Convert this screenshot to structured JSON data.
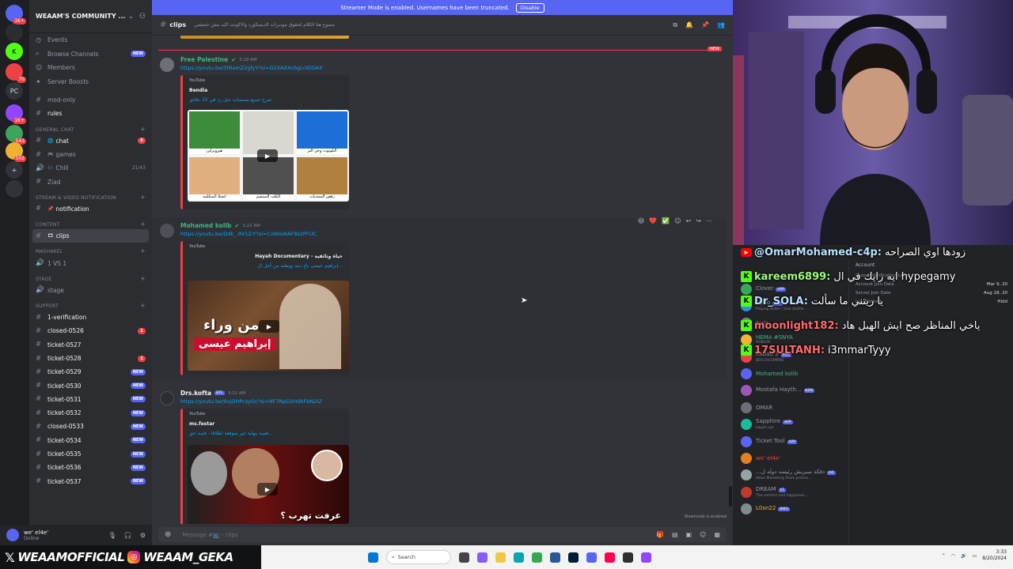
{
  "banner": {
    "text": "Streamer Mode is enabled. Usernames have been truncated.",
    "button": "Disable"
  },
  "rail": {
    "servers": [
      {
        "label": "",
        "badge": "1K+"
      },
      {
        "label": "",
        "badge": ""
      },
      {
        "label": "K",
        "badge": ""
      },
      {
        "label": "",
        "badge": "70"
      },
      {
        "label": "PC",
        "badge": ""
      },
      {
        "label": "",
        "badge": "1K+"
      },
      {
        "label": "",
        "badge": "543"
      },
      {
        "label": "",
        "badge": "502"
      },
      {
        "label": "+",
        "badge": ""
      },
      {
        "label": "",
        "badge": ""
      }
    ]
  },
  "sidebar": {
    "server_name": "WEAAM'S COMMUNITY ...",
    "nav": [
      {
        "icon": "◷",
        "label": "Events",
        "pill": ""
      },
      {
        "icon": "⌕",
        "label": "Browse Channels",
        "pill": "NEW"
      },
      {
        "icon": "☺",
        "label": "Members",
        "pill": ""
      },
      {
        "icon": "✦",
        "label": "Server Boosts",
        "pill": ""
      }
    ],
    "top_channels": [
      {
        "label": "mod-only",
        "active": false,
        "bright": false,
        "count": "",
        "pill": "",
        "tail": ""
      },
      {
        "label": "rules",
        "active": false,
        "bright": true,
        "count": "",
        "pill": "",
        "tail": ""
      }
    ],
    "cat_general": "GENERAL CHAT",
    "general": [
      {
        "label": "chat",
        "emoji": "🌐",
        "count": "6",
        "tail": ""
      },
      {
        "label": "games",
        "emoji": "🎮",
        "count": "",
        "tail": ""
      },
      {
        "label": "Chill",
        "emoji": "🎶",
        "count": "",
        "tail": "21/43"
      },
      {
        "label": "Ziad",
        "emoji": "",
        "count": "",
        "tail": ""
      }
    ],
    "cat_stream": "STREAM & VIDEO NOTIFICATION",
    "stream": [
      {
        "label": "notification",
        "emoji": "📌"
      }
    ],
    "cat_content": "CONTENT",
    "content": [
      {
        "label": "clips",
        "emoji": "🎞"
      }
    ],
    "cat_mashakel": "MASHAKEL",
    "mashakel": [
      {
        "label": "1 VS 1"
      }
    ],
    "cat_stage": "STAGE",
    "stage": [
      {
        "label": "stage"
      }
    ],
    "cat_support": "SUPPORT",
    "support": [
      {
        "label": "1-verification",
        "count": "",
        "pill": ""
      },
      {
        "label": "closed-0526",
        "count": "1",
        "pill": ""
      },
      {
        "label": "ticket-0527",
        "count": "",
        "pill": ""
      },
      {
        "label": "ticket-0528",
        "count": "1",
        "pill": ""
      },
      {
        "label": "ticket-0529",
        "count": "",
        "pill": "NEW"
      },
      {
        "label": "ticket-0530",
        "count": "",
        "pill": "NEW"
      },
      {
        "label": "ticket-0531",
        "count": "",
        "pill": "NEW"
      },
      {
        "label": "ticket-0532",
        "count": "",
        "pill": "NEW"
      },
      {
        "label": "closed-0533",
        "count": "",
        "pill": "NEW"
      },
      {
        "label": "ticket-0534",
        "count": "",
        "pill": "NEW"
      },
      {
        "label": "ticket-0535",
        "count": "",
        "pill": "NEW"
      },
      {
        "label": "ticket-0536",
        "count": "",
        "pill": "NEW"
      },
      {
        "label": "ticket-0537",
        "count": "",
        "pill": "NEW"
      }
    ]
  },
  "user": {
    "name": "we' el4e'",
    "status": "Online"
  },
  "chat_header": {
    "channel": "clips",
    "topic": "ممنوع هنا الكلام لحقوق موديرات الديسكورد والاكونت اكيد مش حتمشي"
  },
  "messages": [
    {
      "author": "Free Palestine",
      "time": "3:19 AM",
      "badge": "",
      "link": "https://youtu.be/3tRamZ2gfyY?si=D2XAXXcbgLnlDOAX",
      "provider": "YouTube",
      "channel": "Bendia",
      "title": "شرح جميع صمصات جيل زد في 15 دقائق",
      "grid": [
        "هيروبراين",
        "",
        "البلوتوث وجن البر",
        "انجيلا المتكلمة",
        "الكلب المبتسم",
        "رقص المنتديات"
      ]
    },
    {
      "author": "Mohamed kolib",
      "time": "3:22 AM",
      "badge": "",
      "link": "https://youtu.be/Ddk_-9V1Z-Y?si=CxIbIsi6AF8s2PFUC",
      "provider": "YouTube",
      "channel": "Hayah Documentary - حياة وثائقية",
      "title": "إبراهيم عيسى باع دينه ووطنه من أجل ال...",
      "thumb_text_1": "من وراء",
      "thumb_text_2": "إبراهيم عيسى"
    },
    {
      "author": "Drs.kofta",
      "time": "3:22 AM",
      "badge": "BTC",
      "link": "https://youtu.be/9ujOHPcsyOc?si=NF7NpD2HdkFbN2IZ",
      "provider": "YouTube",
      "channel": "ms.festar",
      "title": "قصة بنهاية غير متوقعة اطلاقا - قصة حق...",
      "thumb_text_1": "عرفت تهرب ؟"
    }
  ],
  "hover_reactions": [
    "😆",
    "❤️",
    "✅"
  ],
  "slowmode": "Slowmode is enabled",
  "composer": {
    "placeholder": "Message #📺・clips"
  },
  "stream_chat": [
    {
      "platform": "yt",
      "user": "@OmarMohamed-c4p:",
      "text": "زودها اوي الصراحه",
      "color": "u-blue"
    },
    {
      "platform": "kick",
      "user": "kareem6899:",
      "text": "ايه رايك في ال hypegamy",
      "color": "u-green"
    },
    {
      "platform": "kick",
      "user": "Dr_SOLA:",
      "text": "يا ريتني ما سألت",
      "color": "u-blue"
    },
    {
      "platform": "kick",
      "user": "moonlight182:",
      "text": "ياخي المناظر صح ايش الهبل هاد",
      "color": "u-red"
    },
    {
      "platform": "kick",
      "user": "17SULTANH:",
      "text": "i3mmarTyyy",
      "color": "u-red"
    }
  ],
  "account_panel": {
    "title": "Account",
    "rows": [
      {
        "label": "Passed Verification Level",
        "value": ""
      },
      {
        "label": "Account Join Date",
        "value": "Mar 9, 20"
      },
      {
        "label": "Server Join Date",
        "value": "Aug 18, 20"
      },
      {
        "label": "Join Method",
        "value": "Hidd"
      }
    ]
  },
  "members": [
    {
      "name": "Clover",
      "sub": "",
      "tag": "APP",
      "color": ""
    },
    {
      "name": "Dyno",
      "sub": "Playing Better / Use /bottle",
      "tag": "APP",
      "color": ""
    },
    {
      "name": "Faris",
      "sub": "",
      "tag": "",
      "color": ""
    },
    {
      "name": "HEMA #SNYA",
      "sub": "ROBLOX",
      "tag": "",
      "color": "green"
    },
    {
      "name": "Kabab 3",
      "sub": "BOCCHI EMPIRE",
      "tag": "PEN",
      "color": ""
    },
    {
      "name": "Mohamed kolib",
      "sub": "",
      "tag": "",
      "color": "green"
    },
    {
      "name": "Mostafa Hayth...",
      "sub": "",
      "tag": "KZN",
      "color": ""
    },
    {
      "name": "OMAR",
      "sub": "",
      "tag": "",
      "color": ""
    },
    {
      "name": "Sapphire",
      "sub": "sapph.xyz",
      "tag": "APP",
      "color": ""
    },
    {
      "name": "Ticket Tool",
      "sub": "",
      "tag": "APP",
      "color": ""
    },
    {
      "name": "we' el4e'",
      "sub": "",
      "tag": "",
      "color": "red"
    },
    {
      "name": "...دفكة سبريش رئيسه دوله ل",
      "sub": "Velox Marketing Team premiu...",
      "tag": "AR",
      "color": ""
    },
    {
      "name": "DREAM",
      "sub": "The comfort and happiness...",
      "tag": "YT",
      "color": ""
    },
    {
      "name": "L0sn22",
      "sub": "",
      "tag": "BMO",
      "color": "gold"
    }
  ],
  "socials": {
    "x_handle": "WEAAMOFFICIAL",
    "ig_handle": "WEAAM_GEKA"
  },
  "taskbar": {
    "search": "Search",
    "time": "3:33",
    "date": "8/20/2024"
  }
}
